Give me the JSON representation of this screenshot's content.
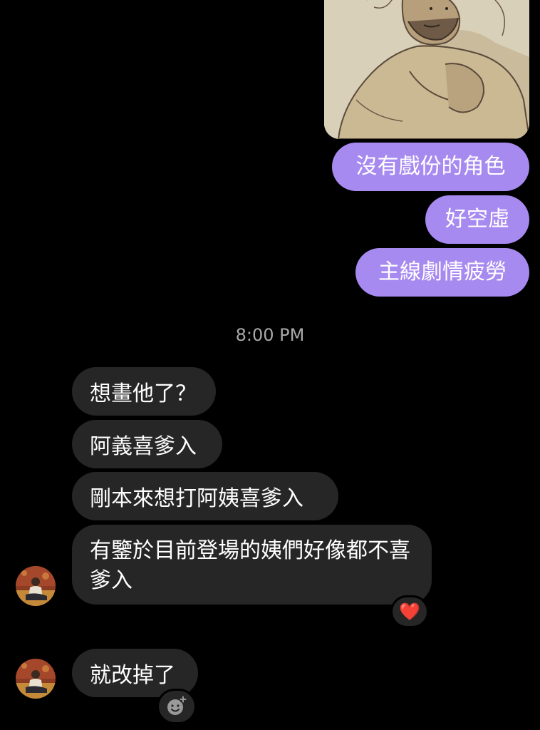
{
  "outgoing": [
    {
      "text": "沒有戲份的角色"
    },
    {
      "text": "好空虛"
    },
    {
      "text": "主線劇情疲勞"
    }
  ],
  "timestamp": "8:00 PM",
  "incoming": [
    {
      "text": "想畫他了？"
    },
    {
      "text": "阿義喜爹入"
    },
    {
      "text": "剛本來想打阿姨喜爹入"
    },
    {
      "text": "有鑒於目前登場的姨們好像都不喜爹入"
    },
    {
      "text": "就改掉了"
    }
  ],
  "reaction_emoji": "❤️",
  "colors": {
    "background": "#000000",
    "outgoing_bubble": "#a78af0",
    "incoming_bubble": "#262626",
    "timestamp": "#a8a8a8"
  },
  "icons": [
    "shared-sketch-image",
    "avatar",
    "heart-reaction-icon",
    "add-reaction-icon"
  ]
}
